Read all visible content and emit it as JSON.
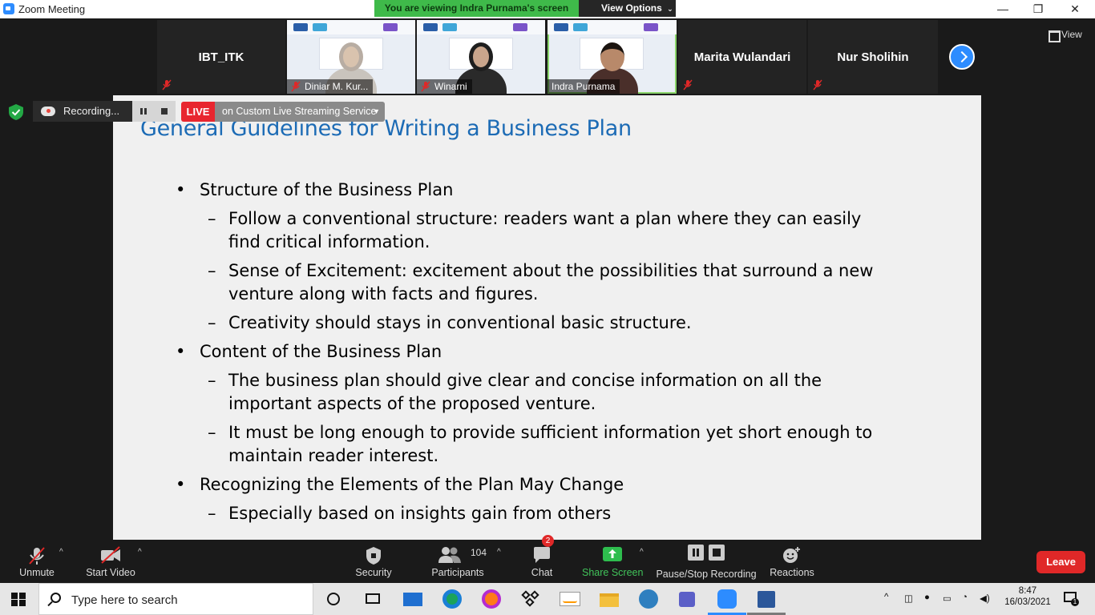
{
  "window": {
    "title": "Zoom Meeting",
    "viewing_banner": "You are viewing Indra Purnama's screen",
    "view_options": "View Options",
    "minimize": "—",
    "maximize": "❐",
    "close": "✕"
  },
  "gallery": {
    "view_label": "View",
    "tiles": [
      {
        "name": "IBT_ITK"
      },
      {
        "name": "Diniar M. Kur..."
      },
      {
        "name": "Winarni"
      },
      {
        "name": "Indra Purnama"
      },
      {
        "name": "Marita Wulandari"
      },
      {
        "name": "Nur Sholihin"
      }
    ]
  },
  "recording": {
    "status": "Recording...",
    "live_label": "LIVE",
    "live_service": "on Custom Live Streaming Service"
  },
  "slide": {
    "title": "General Guidelines for Writing a Business Plan",
    "b1": "Structure of the Business Plan",
    "b1s1": "Follow a conventional structure: readers want a plan where they can easily find critical information.",
    "b1s2": "Sense of Excitement: excitement about the possibilities that surround a new venture along with facts and figures.",
    "b1s3": "Creativity should stays in conventional basic structure.",
    "b2": "Content of the Business Plan",
    "b2s1": "The business plan should give clear and concise information on all the important aspects of the proposed venture.",
    "b2s2": "It must be long enough to provide sufficient information yet short enough to maintain reader interest.",
    "b3": "Recognizing the Elements of the Plan May Change",
    "b3s1": "Especially based on insights gain from others"
  },
  "controls": {
    "unmute": "Unmute",
    "start_video": "Start Video",
    "security": "Security",
    "participants": "Participants",
    "participants_count": "104",
    "chat": "Chat",
    "chat_badge": "2",
    "share_screen": "Share Screen",
    "pause_stop_recording": "Pause/Stop Recording",
    "reactions": "Reactions",
    "leave": "Leave"
  },
  "taskbar": {
    "search_placeholder": "Type here to search",
    "time": "8:47",
    "date": "16/03/2021"
  },
  "colors": {
    "zoom_blue": "#2d8cff",
    "banner_green": "#3fba4a",
    "live_red": "#e8262f",
    "slide_title_blue": "#1c6bb5",
    "leave_red": "#e02828"
  }
}
